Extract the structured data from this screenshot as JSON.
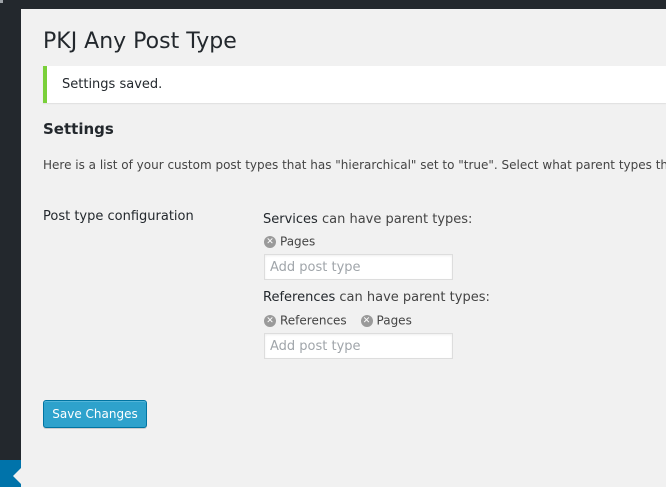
{
  "page": {
    "title": "PKJ Any Post Type"
  },
  "notice": {
    "text": "Settings saved."
  },
  "settings": {
    "heading": "Settings",
    "description": "Here is a list of your custom post types that has \"hierarchical\" set to \"true\". Select what parent types that",
    "row_label": "Post type configuration",
    "suffix": "can have parent types:",
    "configs": [
      {
        "post_type": "Services",
        "parents": [
          "Pages"
        ],
        "input_placeholder": "Add post type"
      },
      {
        "post_type": "References",
        "parents": [
          "References",
          "Pages"
        ],
        "input_placeholder": "Add post type"
      }
    ]
  },
  "actions": {
    "save_label": "Save Changes"
  },
  "colors": {
    "primary_button": "#2ea2cc",
    "notice_success": "#7ad03a",
    "admin_bar": "#23282d",
    "menu_current": "#0073aa"
  },
  "icons": {
    "remove_tag": "x-circle-icon",
    "sidebar_collapse": "arrow-left-icon"
  }
}
